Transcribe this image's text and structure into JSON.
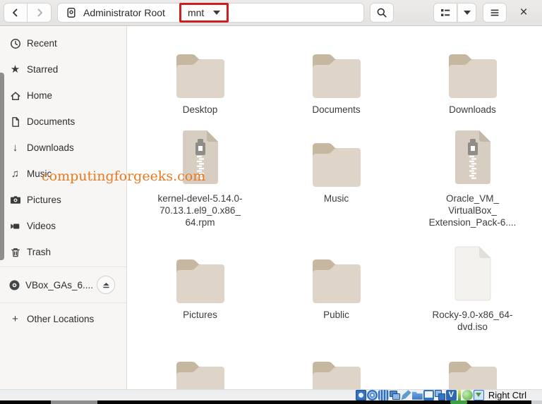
{
  "toolbar": {
    "path": {
      "root": "Administrator Root",
      "current": "mnt"
    },
    "icons": [
      "chevron-left-icon",
      "chevron-right-icon",
      "drive-root-icon",
      "caret-down-icon",
      "search-icon",
      "list-view-icon",
      "view-caret-icon",
      "hamburger-menu-icon",
      "close-icon"
    ],
    "close_glyph": "×"
  },
  "sidebar": {
    "items": [
      {
        "label": "Recent",
        "icon": "clock-icon"
      },
      {
        "label": "Starred",
        "icon": "star-icon"
      },
      {
        "label": "Home",
        "icon": "home-icon"
      },
      {
        "label": "Documents",
        "icon": "document-icon"
      },
      {
        "label": "Downloads",
        "icon": "download-arrow-icon"
      },
      {
        "label": "Music",
        "icon": "music-notes-icon"
      },
      {
        "label": "Pictures",
        "icon": "camera-icon"
      },
      {
        "label": "Videos",
        "icon": "camcorder-icon"
      },
      {
        "label": "Trash",
        "icon": "trash-icon"
      }
    ],
    "device": {
      "label": "VBox_GAs_6....",
      "icon": "optical-disc-icon",
      "eject_icon": "eject-icon"
    },
    "other_locations": {
      "label": "Other Locations",
      "icon": "plus-icon"
    },
    "glyphs": {
      "star": "★",
      "download_arrow": "↓",
      "music": "♫",
      "plus": "+"
    }
  },
  "main": {
    "items": [
      {
        "label": "Desktop",
        "type": "folder"
      },
      {
        "label": "Documents",
        "type": "folder"
      },
      {
        "label": "Downloads",
        "type": "folder"
      },
      {
        "label": "kernel-devel-5.14.0-\n70.13.1.el9_0.x86_\n64.rpm",
        "type": "archive"
      },
      {
        "label": "Music",
        "type": "folder"
      },
      {
        "label": "Oracle_VM_\nVirtualBox_\nExtension_Pack-6....",
        "type": "archive"
      },
      {
        "label": "Pictures",
        "type": "folder"
      },
      {
        "label": "Public",
        "type": "folder"
      },
      {
        "label": "Rocky-9.0-x86_64-\ndvd.iso",
        "type": "iso"
      }
    ],
    "partial_row_types": [
      "folder",
      "folder",
      "folder"
    ]
  },
  "watermark": {
    "text": "computingforgeeks.com",
    "color": "#e8791f"
  },
  "statusbar": {
    "host_key_label": "Right Ctrl",
    "icons": [
      "hard-disk-icon",
      "optical-disc-icon",
      "audio-icon",
      "network-icon",
      "usb-icon",
      "shared-folder-icon",
      "display-icon",
      "clipboard-icon",
      "video-capture-icon",
      "features-indicator",
      "mouse-integration-icon",
      "keyboard-icon"
    ]
  },
  "annotation": {
    "highlight_color": "#cc1f1f"
  },
  "colors": {
    "folder_front": "#ded4c7",
    "folder_tab": "#c6b7a1",
    "toolbar_bg": "#e9e7e5",
    "sidebar_bg": "#f7f6f5"
  }
}
